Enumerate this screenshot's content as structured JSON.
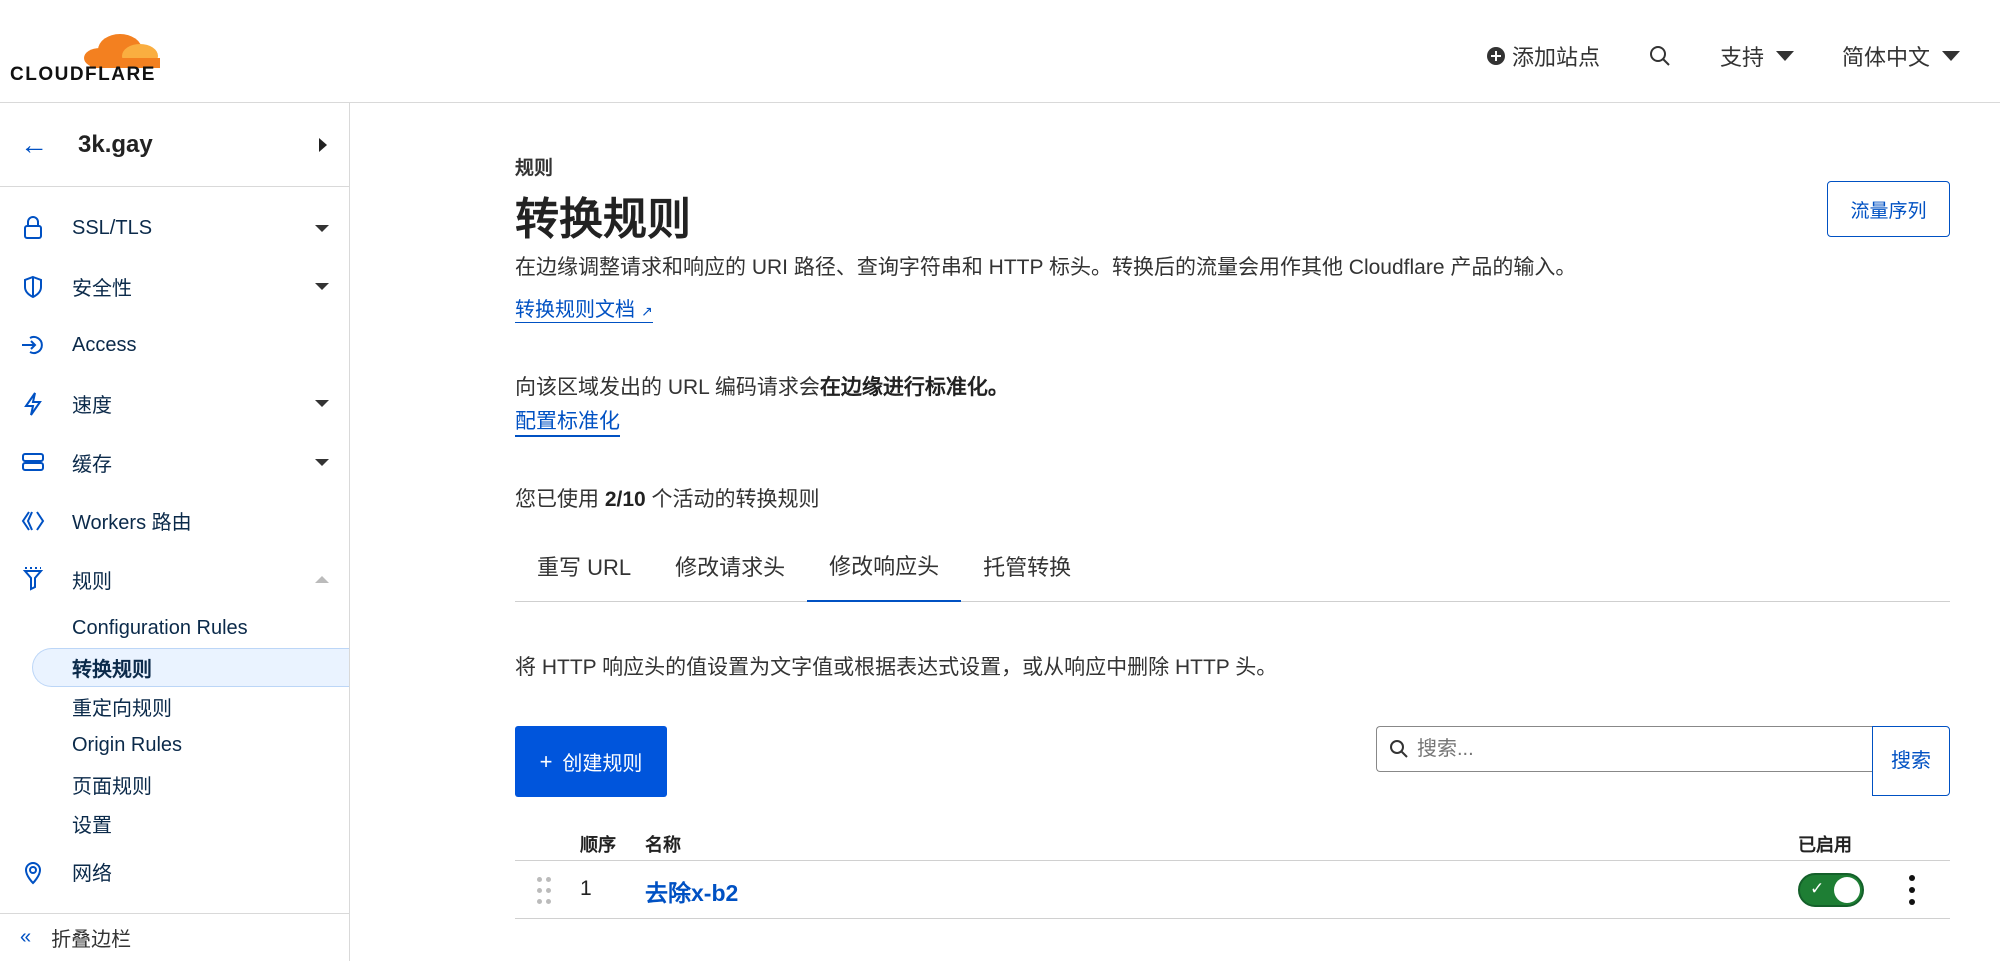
{
  "brand": {
    "name": "CLOUDFLARE",
    "orange": "#f38020",
    "accent": "#0051c3"
  },
  "topbar": {
    "add_site": "添加站点",
    "support": "支持",
    "language": "简体中文"
  },
  "sidebar": {
    "site": "3k.gay",
    "items": [
      {
        "label": "SSL/TLS",
        "icon": "lock-icon"
      },
      {
        "label": "安全性",
        "icon": "shield-icon"
      },
      {
        "label": "Access",
        "icon": "access-icon"
      },
      {
        "label": "速度",
        "icon": "lightning-icon"
      },
      {
        "label": "缓存",
        "icon": "cache-icon"
      },
      {
        "label": "Workers 路由",
        "icon": "workers-icon"
      },
      {
        "label": "规则",
        "icon": "rules-icon"
      }
    ],
    "rules_sub": [
      "Configuration Rules",
      "转换规则",
      "重定向规则",
      "Origin Rules",
      "页面规则",
      "设置"
    ],
    "network": "网络",
    "collapse": "折叠边栏"
  },
  "main": {
    "breadcrumb": "规则",
    "title": "转换规则",
    "description": "在边缘调整请求和响应的 URI 路径、查询字符串和 HTTP 标头。转换后的流量会用作其他 Cloudflare 产品的输入。",
    "doc_link": "转换规则文档",
    "traffic_button": "流量序列",
    "norm_prefix": "向该区域发出的 URL 编码请求会",
    "norm_bold": "在边缘进行标准化。",
    "norm_link": "配置标准化",
    "usage_prefix": "您已使用 ",
    "usage_count": "2/10",
    "usage_suffix": " 个活动的转换规则",
    "tabs": [
      "重写 URL",
      "修改请求头",
      "修改响应头",
      "托管转换"
    ],
    "active_tab": 2,
    "tab_description": "将 HTTP 响应头的值设置为文字值或根据表达式设置，或从响应中删除 HTTP 头。",
    "create_button": "创建规则",
    "search_placeholder": "搜索...",
    "search_button": "搜索",
    "table": {
      "headers": {
        "order": "顺序",
        "name": "名称",
        "enabled": "已启用"
      },
      "rows": [
        {
          "order": "1",
          "name": "去除x-b2",
          "enabled": true
        }
      ]
    }
  }
}
